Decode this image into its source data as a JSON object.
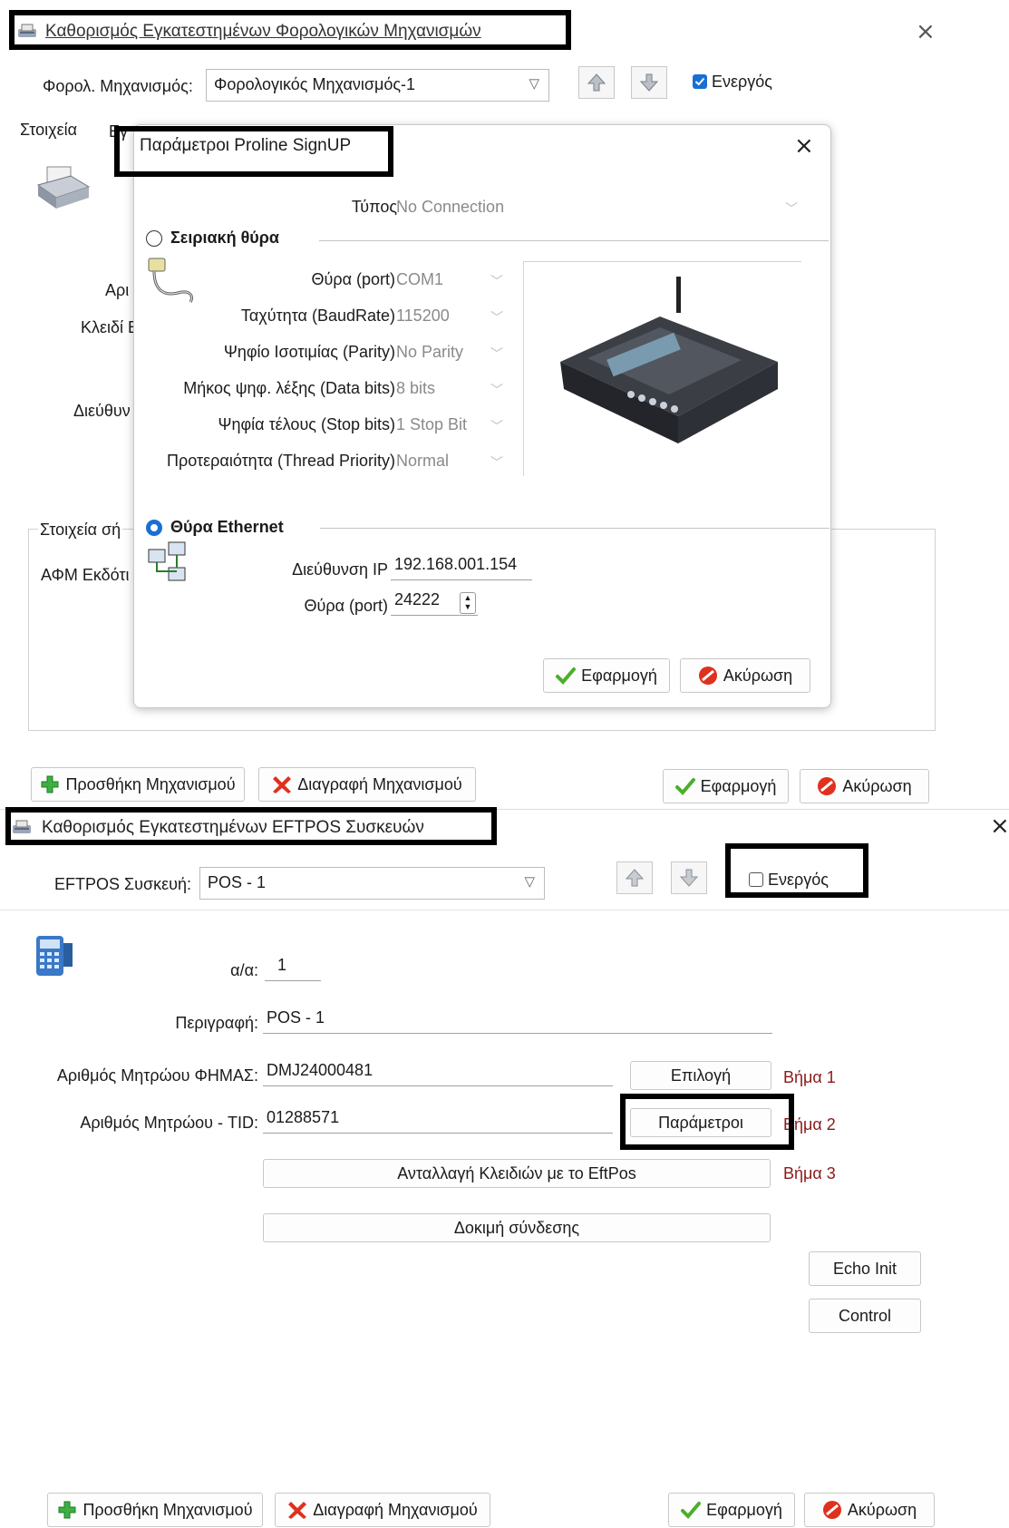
{
  "top_window": {
    "title": "Καθορισμός Εγκατεστημένων Φορολογικών Μηχανισμών",
    "close": "×",
    "mechanism_label": "Φορολ. Μηχανισμός:",
    "mechanism_value": "Φορολογικός Μηχανισμός-1",
    "active_label": "Ενεργός",
    "active_checked": true,
    "tab_label": "Στοιχεία",
    "tab_label_2": "Εγ",
    "partial_labels": [
      "Αρι",
      "Κλειδί Ε",
      "Διεύθυν",
      "Στοιχεία σή",
      "ΑΦΜ Εκδότι"
    ],
    "add_button": "Προσθήκη Μηχανισμού",
    "delete_button": "Διαγραφή Μηχανισμού",
    "apply_button": "Εφαρμογή",
    "cancel_button": "Ακύρωση"
  },
  "dialog": {
    "title": "Παράμετροι Proline SignUP",
    "close": "×",
    "type_label": "Τύπος",
    "type_value": "No Connection",
    "serial_label": "Σειριακή θύρα",
    "serial_fields": [
      {
        "label": "Θύρα (port)",
        "value": "COM1"
      },
      {
        "label": "Ταχύτητα (BaudRate)",
        "value": "115200"
      },
      {
        "label": "Ψηφίο Ισοτιμίας (Parity)",
        "value": "No Parity"
      },
      {
        "label": "Μήκος ψηφ. λέξης (Data bits)",
        "value": "8 bits"
      },
      {
        "label": "Ψηφία τέλους (Stop bits)",
        "value": "1 Stop Bit"
      },
      {
        "label": "Προτεραιότητα (Thread Priority)",
        "value": "Normal"
      }
    ],
    "ethernet_label": "Θύρα Ethernet",
    "ip_label": "Διεύθυνση IP",
    "ip_value": "192.168.001.154",
    "port_label": "Θύρα (port)",
    "port_value": "24222",
    "apply_button": "Εφαρμογή",
    "cancel_button": "Ακύρωση"
  },
  "eftpos_window": {
    "title": "Καθορισμός Εγκατεστημένων EFTPOS Συσκευών",
    "close": "×",
    "device_label": "EFTPOS Συσκευή:",
    "device_value": "POS - 1",
    "active_label": "Ενεργός",
    "active_checked": false,
    "aa_label": "α/α:",
    "aa_value": "1",
    "desc_label": "Περιγραφή:",
    "desc_value": "POS - 1",
    "fhmas_label": "Αριθμός Μητρώου ΦΗΜΑΣ:",
    "fhmas_value": "DMJ24000481",
    "tid_label": "Αριθμός Μητρώου - TID:",
    "tid_value": "01288571",
    "select_button": "Επιλογή",
    "params_button": "Παράμετροι",
    "exchange_button": "Ανταλλαγή Κλειδιών με το EftPos",
    "test_button": "Δοκιμή σύνδεσης",
    "echo_button": "Echo Init",
    "control_button": "Control",
    "step1": "Βήμα 1",
    "step2": "Βήμα 2",
    "step3": "Βήμα 3",
    "add_button": "Προσθήκη Μηχανισμού",
    "delete_button": "Διαγραφή Μηχανισμού",
    "apply_button": "Εφαρμογή",
    "cancel_button": "Ακύρωση"
  },
  "colors": {
    "accent": "#1a6fd4",
    "step_text": "#8b1a1a",
    "highlight_border": "#000000"
  }
}
